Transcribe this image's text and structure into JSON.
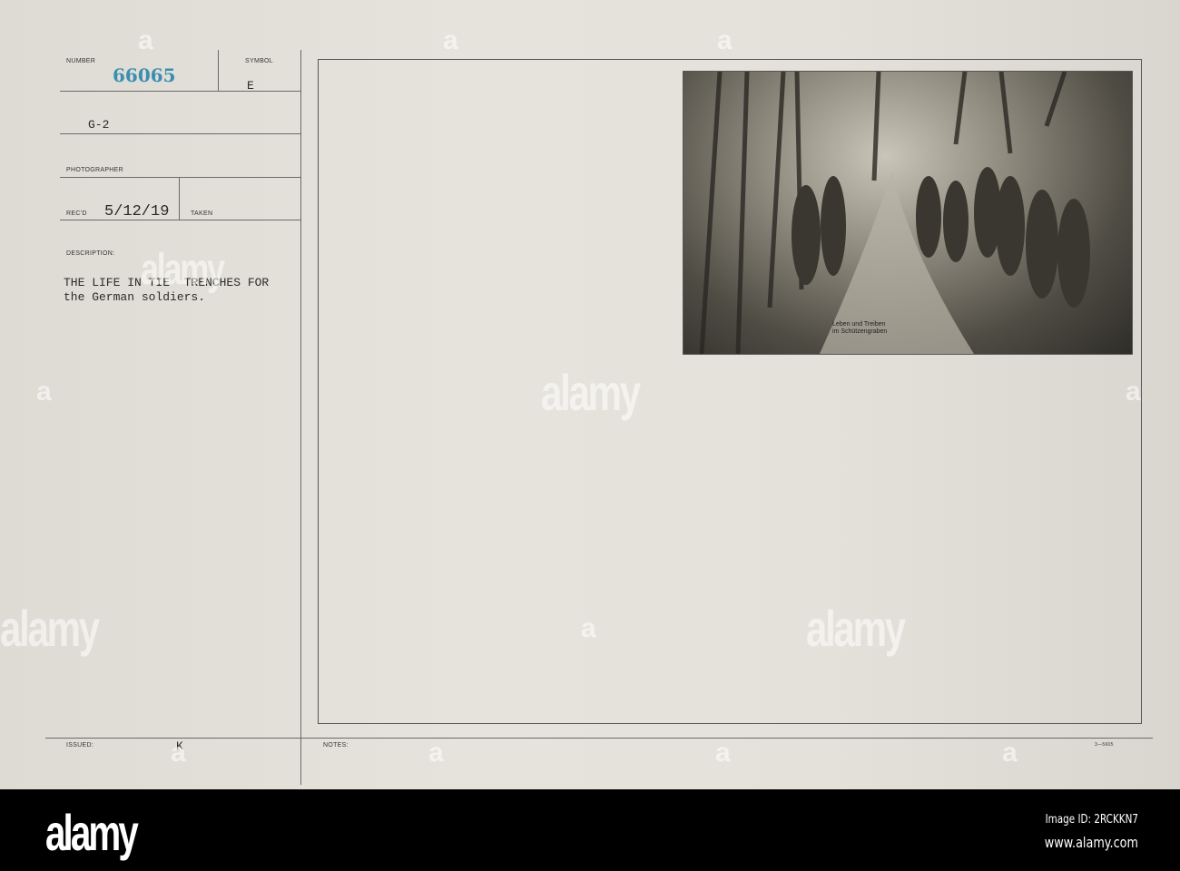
{
  "card": {
    "number_label": "NUMBER",
    "number": "66065",
    "number_color": "#3a8fb0",
    "symbol_label": "SYMBOL",
    "symbol": "E",
    "unit": "G-2",
    "photographer_label": "PHOTOGRAPHER",
    "recd_label": "REC'D",
    "recd": "5/12/19",
    "taken_label": "TAKEN",
    "description_label": "DESCRIPTION:",
    "description_line1": "THE LIFE IN TIE  TRENCHES FOR",
    "description_line2": "the German soldiers.",
    "issued_label": "ISSUED:",
    "issued_mark": "K",
    "notes_label": "NOTES:",
    "form_number": "3—5605"
  },
  "photo": {
    "caption_line1": "Leben und Treiben",
    "caption_line2": "im Schützengraben"
  },
  "watermark": {
    "text": "alamy",
    "letter": "a"
  },
  "footer": {
    "logo": "alamy",
    "image_id": "Image ID: 2RCKKN7",
    "url": "www.alamy.com"
  }
}
